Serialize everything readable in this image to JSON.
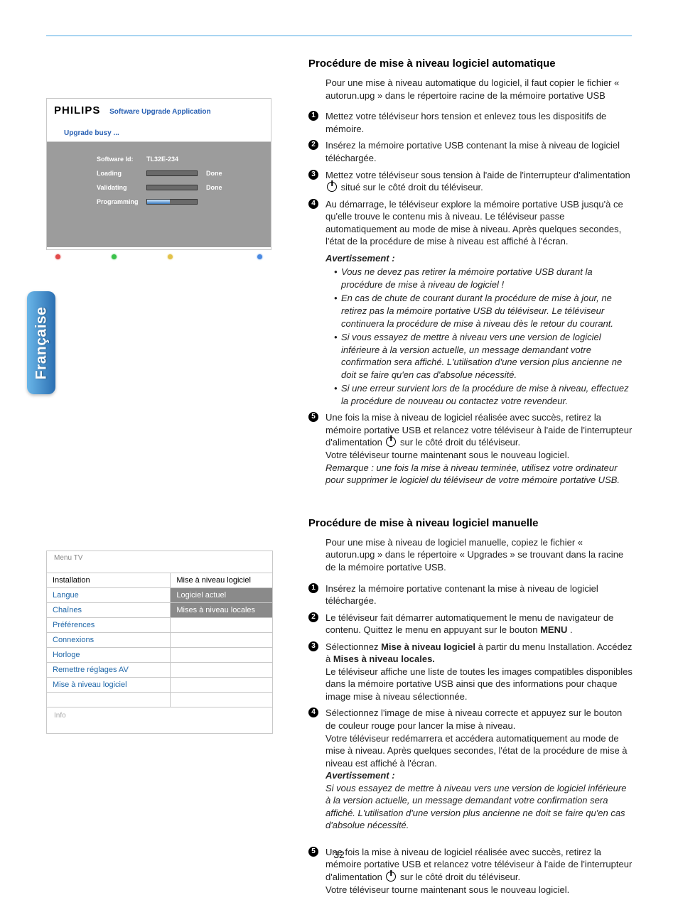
{
  "lang_tab": "Française",
  "page_number": "32",
  "upgrade_app": {
    "brand": "PHILIPS",
    "title": "Software Upgrade Application",
    "status": "Upgrade busy ...",
    "id_label": "Software Id:",
    "id_value": "TL32E-234",
    "rows": {
      "loading": {
        "label": "Loading",
        "done": "Done"
      },
      "validating": {
        "label": "Validating",
        "done": "Done"
      },
      "programming": {
        "label": "Programming",
        "done": ""
      }
    }
  },
  "menu": {
    "header": "Menu TV",
    "left_heading": "Installation",
    "right_heading": "Mise à niveau logiciel",
    "left_items": [
      "Langue",
      "Chaînes",
      "Préférences",
      "Connexions",
      "Horloge",
      "Remettre réglages AV",
      "Mise à niveau logiciel"
    ],
    "right_items": [
      "Logiciel actuel",
      "Mises à niveau locales",
      "",
      "",
      "",
      "",
      ""
    ],
    "footer": "Info"
  },
  "sec1": {
    "title": "Procédure de mise à niveau logiciel automatique",
    "intro": "Pour une mise à niveau automatique du logiciel, il faut copier le fichier « autorun.upg » dans le répertoire racine de la mémoire portative USB",
    "s1": "Mettez votre téléviseur hors tension et enlevez tous les dispositifs de mémoire.",
    "s2": "Insérez la mémoire portative USB contenant la mise à niveau de logiciel téléchargée.",
    "s3a": "Mettez votre téléviseur sous tension à l'aide de l'interrupteur d'alimentation",
    "s3b": " situé sur le côté droit du téléviseur.",
    "s4": "Au démarrage, le téléviseur explore la mémoire portative USB jusqu'à ce qu'elle trouve le contenu mis à niveau. Le téléviseur passe automatiquement au mode de mise à niveau. Après quelques secondes, l'état de la procédure de mise à niveau est affiché à l'écran.",
    "warn_head": "Avertissement :",
    "warns": [
      "Vous ne devez pas retirer la mémoire portative USB durant la procédure de mise à niveau de logiciel !",
      "En cas de chute de courant durant la procédure de mise à jour, ne retirez pas la mémoire portative USB du téléviseur. Le téléviseur continuera la procédure de mise à niveau dès le retour du courant.",
      "Si vous essayez de mettre à niveau vers une version de logiciel inférieure à la version actuelle, un message demandant votre confirmation sera affiché. L'utilisation d'une version plus ancienne ne doit se faire qu'en cas d'absolue nécessité.",
      "Si une erreur survient lors de la procédure de mise à niveau, effectuez la procédure de nouveau ou contactez votre revendeur."
    ],
    "s5a": "Une fois la mise à niveau de logiciel réalisée avec succès, retirez la mémoire portative USB et relancez votre téléviseur à l'aide de l'interrupteur d'alimentation ",
    "s5b": " sur le côté droit du téléviseur.",
    "s5c": "Votre téléviseur tourne maintenant sous le nouveau logiciel.",
    "s5_note": "Remarque : une fois la mise à niveau terminée, utilisez votre ordinateur pour supprimer le logiciel du téléviseur de votre mémoire portative USB."
  },
  "sec2": {
    "title": "Procédure de mise à niveau logiciel manuelle",
    "intro": "Pour une mise à niveau de logiciel manuelle, copiez le fichier « autorun.upg » dans le répertoire « Upgrades » se trouvant dans la racine de la mémoire portative USB.",
    "s1": "Insérez la mémoire portative contenant la mise à niveau de logiciel téléchargée.",
    "s2a": "Le téléviseur fait démarrer automatiquement le menu de navigateur de contenu. Quittez le menu en appuyant sur le bouton ",
    "s2_menu": "MENU",
    "s2b": ".",
    "s3a": "Sélectionnez ",
    "s3_b1": "Mise à niveau logiciel",
    "s3b": " à partir du menu Installation. Accédez à ",
    "s3_b2": "Mises à niveau locales.",
    "s3c": "Le téléviseur affiche une liste de toutes les images compatibles disponibles dans la mémoire portative USB ainsi que des informations pour chaque image mise à niveau sélectionnée.",
    "s4a": "Sélectionnez l'image de mise à niveau correcte et appuyez sur le bouton de couleur rouge pour lancer la mise à niveau.",
    "s4b": "Votre téléviseur redémarrera et accédera automatiquement au mode de mise à niveau. Après quelques secondes, l'état de la procédure de mise à niveau est affiché à l'écran.",
    "s4_warn_h": "Avertissement :",
    "s4_warn": "Si vous essayez de mettre à niveau vers une version de logiciel inférieure à la version actuelle, un message demandant votre confirmation sera affiché. L'utilisation d'une version plus ancienne ne doit se faire qu'en cas d'absolue nécessité.",
    "s5a": "Une fois la mise à niveau de logiciel réalisée avec succès, retirez la mémoire portative USB et relancez votre téléviseur à l'aide de l'interrupteur d'alimentation ",
    "s5b": " sur le côté droit du téléviseur.",
    "s5c": "Votre téléviseur tourne maintenant sous le nouveau logiciel."
  }
}
